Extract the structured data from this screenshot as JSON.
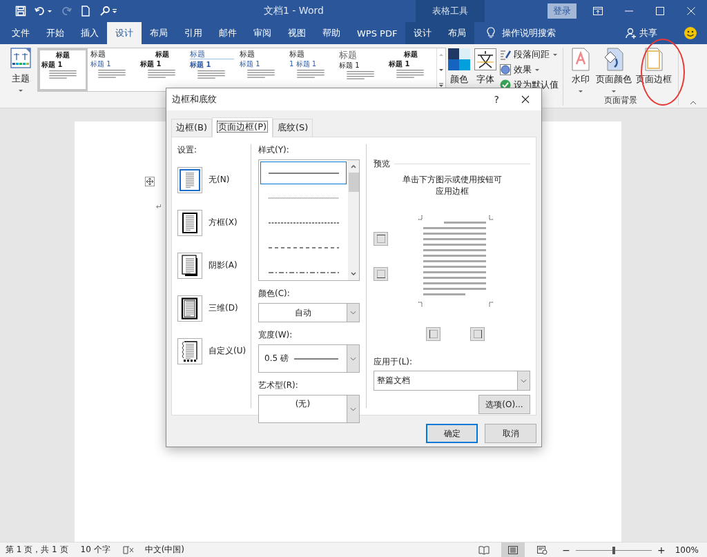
{
  "quick_access": [
    {
      "kind": "save",
      "disabled": false
    },
    {
      "kind": "undo",
      "disabled": false
    },
    {
      "kind": "menu-caret",
      "disabled": false
    },
    {
      "kind": "redo",
      "disabled": true
    },
    {
      "kind": "new",
      "disabled": false
    },
    {
      "kind": "search",
      "disabled": false
    },
    {
      "kind": "customize",
      "disabled": false
    }
  ],
  "window": {
    "title": "文档1  -  Word",
    "context_group": "表格工具",
    "sign_in": "登录"
  },
  "tabs": [
    {
      "label": "文件",
      "selected": false
    },
    {
      "label": "开始",
      "selected": false
    },
    {
      "label": "插入",
      "selected": false
    },
    {
      "label": "设计",
      "selected": true
    },
    {
      "label": "布局",
      "selected": false
    },
    {
      "label": "引用",
      "selected": false
    },
    {
      "label": "邮件",
      "selected": false
    },
    {
      "label": "审阅",
      "selected": false
    },
    {
      "label": "视图",
      "selected": false
    },
    {
      "label": "帮助",
      "selected": false
    },
    {
      "label": "WPS PDF",
      "selected": false
    }
  ],
  "context_tabs": [
    {
      "label": "设计",
      "selected": false
    },
    {
      "label": "布局",
      "selected": false
    }
  ],
  "tell_me": "操作说明搜索",
  "share": "共享",
  "ribbon": {
    "theme_button": "主题",
    "style_gallery": [
      {
        "kind": "centered",
        "title": "标题",
        "heading": "标题 1",
        "selected": true
      },
      {
        "kind": "left",
        "title": "标题",
        "heading": "标题 1",
        "selected": false
      },
      {
        "kind": "centered",
        "title": "标题",
        "heading": "标题 1",
        "selected": false
      },
      {
        "kind": "underlined",
        "title": "标题",
        "heading": "标题 1",
        "selected": false
      },
      {
        "kind": "left",
        "title": "标题",
        "heading": "标题 1",
        "selected": false
      },
      {
        "kind": "left",
        "title": "标题",
        "heading": "1  标题 1",
        "selected": false
      },
      {
        "kind": "large",
        "title": "标题",
        "heading": "标题 1",
        "selected": false
      },
      {
        "kind": "centered",
        "title": "标题",
        "heading": "标题 1",
        "selected": false
      }
    ],
    "colors": "颜色",
    "fonts": "字体",
    "paragraph_spacing": "段落间距",
    "effects": "效果",
    "set_default": "设为默认值",
    "watermark": "水印",
    "page_color": "页面颜色",
    "page_borders": "页面边框",
    "group_label": "页面背景"
  },
  "document": {
    "paragraph_mark": "↵"
  },
  "dialog": {
    "title": "边框和底纹",
    "help": "?",
    "tabs": [
      {
        "label": "边框(B)",
        "selected": false
      },
      {
        "label": "页面边框(P)",
        "selected": true
      },
      {
        "label": "底纹(S)",
        "selected": false
      }
    ],
    "setting_label": "设置:",
    "settings": [
      {
        "kind": "none",
        "label": "无(N)",
        "selected": true
      },
      {
        "kind": "box",
        "label": "方框(X)",
        "selected": false
      },
      {
        "kind": "shadow",
        "label": "阴影(A)",
        "selected": false
      },
      {
        "kind": "threed",
        "label": "三维(D)",
        "selected": false
      },
      {
        "kind": "custom",
        "label": "自定义(U)",
        "selected": false
      }
    ],
    "style_label": "样式(Y):",
    "line_styles": [
      {
        "kind": "solid",
        "selected": true
      },
      {
        "kind": "dotted",
        "selected": false
      },
      {
        "kind": "dashed",
        "selected": false
      },
      {
        "kind": "dashed-wide",
        "selected": false
      },
      {
        "kind": "dash-dot",
        "selected": false
      }
    ],
    "color_label": "颜色(C):",
    "color_value": "自动",
    "width_label": "宽度(W):",
    "width_value": "0.5 磅",
    "art_label": "艺术型(R):",
    "art_value": "(无)",
    "preview_label": "预览",
    "preview_hint": "单击下方图示或使用按钮可应用边框",
    "apply_label": "应用于(L):",
    "apply_value": "整篇文档",
    "options_button": "选项(O)...",
    "ok": "确定",
    "cancel": "取消"
  },
  "status": {
    "page": "第 1 页，共 1 页",
    "words": "10 个字",
    "language": "中文(中国)",
    "views": [
      {
        "kind": "read",
        "selected": false
      },
      {
        "kind": "print",
        "selected": true
      },
      {
        "kind": "web",
        "selected": false
      }
    ],
    "zoom_out": "−",
    "zoom_in": "+",
    "zoom": {
      "level": 0.5,
      "reading": "100%"
    }
  }
}
